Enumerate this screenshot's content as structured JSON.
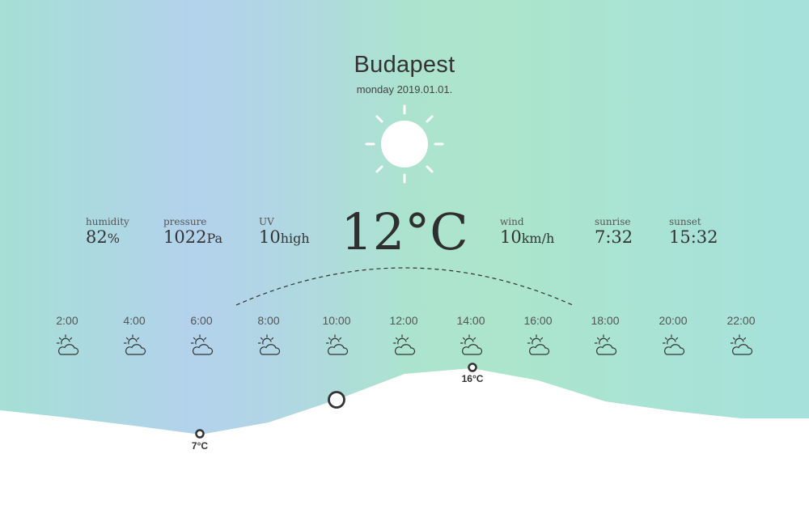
{
  "location": {
    "city": "Budapest",
    "date": "monday 2019.01.01."
  },
  "current": {
    "temperature": "12°C",
    "icon": "sun-icon",
    "stats": [
      {
        "label": "humidity",
        "value": "82",
        "unit": "%"
      },
      {
        "label": "pressure",
        "value": "1022",
        "unit": "Pa"
      },
      {
        "label": "UV",
        "value": "10",
        "unit": "high"
      },
      {
        "label": "wind",
        "value": "10",
        "unit": "km/h"
      },
      {
        "label": "sunrise",
        "value": "7:32",
        "unit": ""
      },
      {
        "label": "sunset",
        "value": "15:32",
        "unit": ""
      }
    ]
  },
  "forecast": {
    "hours": [
      "2:00",
      "4:00",
      "6:00",
      "8:00",
      "10:00",
      "12:00",
      "14:00",
      "16:00",
      "18:00",
      "20:00",
      "22:00"
    ],
    "icon": "partly-cloudy-icon",
    "min_label": "7°C",
    "max_label": "16°C"
  },
  "colors": {
    "bg_teal": "#a6e2d8",
    "bg_blue": "#b2d3ec",
    "bg_green": "#ade5cb",
    "text": "#333333"
  }
}
